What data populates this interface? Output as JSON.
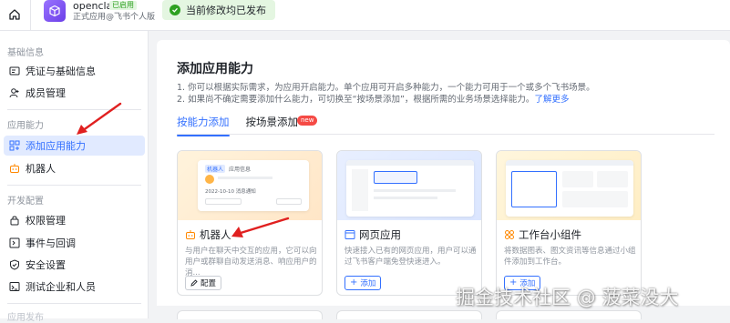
{
  "topbar": {
    "app_name": "openclaw",
    "app_badge": "已启用",
    "app_desc": "正式应用@飞书个人版",
    "publish_status": "当前修改均已发布"
  },
  "sidebar": {
    "groups": [
      {
        "title": "基础信息",
        "items": [
          {
            "label": "凭证与基础信息",
            "icon": "id-card-icon"
          },
          {
            "label": "成员管理",
            "icon": "member-icon"
          }
        ]
      },
      {
        "title": "应用能力",
        "items": [
          {
            "label": "添加应用能力",
            "icon": "grid-add-icon",
            "active": true
          },
          {
            "label": "机器人",
            "icon": "robot-icon"
          }
        ]
      },
      {
        "title": "开发配置",
        "items": [
          {
            "label": "权限管理",
            "icon": "lock-icon"
          },
          {
            "label": "事件与回调",
            "icon": "event-icon"
          },
          {
            "label": "安全设置",
            "icon": "shield-icon"
          },
          {
            "label": "测试企业和人员",
            "icon": "test-icon"
          }
        ]
      },
      {
        "title": "应用发布",
        "items": []
      }
    ]
  },
  "main": {
    "title": "添加应用能力",
    "note1": "1. 你可以根据实际需求，为应用开启能力。单个应用可开启多种能力，一个能力可用于一个或多个飞书场景。",
    "note2_prefix": "2. 如果尚不确定需要添加什么能力，可切换至“按场景添加”，根据所需的业务场景选择能力。",
    "note2_link": "了解更多",
    "tabs": [
      {
        "label": "按能力添加",
        "active": true
      },
      {
        "label": "按场景添加",
        "badge": "new"
      }
    ],
    "cards": [
      {
        "name": "机器人",
        "icon": "robot-icon",
        "desc": "与用户在聊天中交互的应用，它可以向用户或群聊自动发送消息、响应用户的消...",
        "button": "配置",
        "button_icon": "edit-icon",
        "thumb_text_1": "机器人",
        "thumb_text_2": "应用信息",
        "thumb_text_3": "2022-10-10 消息通知"
      },
      {
        "name": "网页应用",
        "icon": "webpage-icon",
        "desc": "快速接入已有的网页应用，用户可以通过飞书客户端免登快速进入。",
        "button": "添加",
        "button_icon": "plus-icon"
      },
      {
        "name": "工作台小组件",
        "icon": "widget-icon",
        "desc": "将数据图表、图文资讯等信息通过小组件添加到工作台。",
        "button": "添加",
        "button_icon": "plus-icon"
      }
    ]
  },
  "watermark": "掘金技术社区 @ 菠菜没大",
  "colors": {
    "accent": "#3370ff",
    "success": "#2ea121",
    "annotation_arrow": "#e02020"
  }
}
